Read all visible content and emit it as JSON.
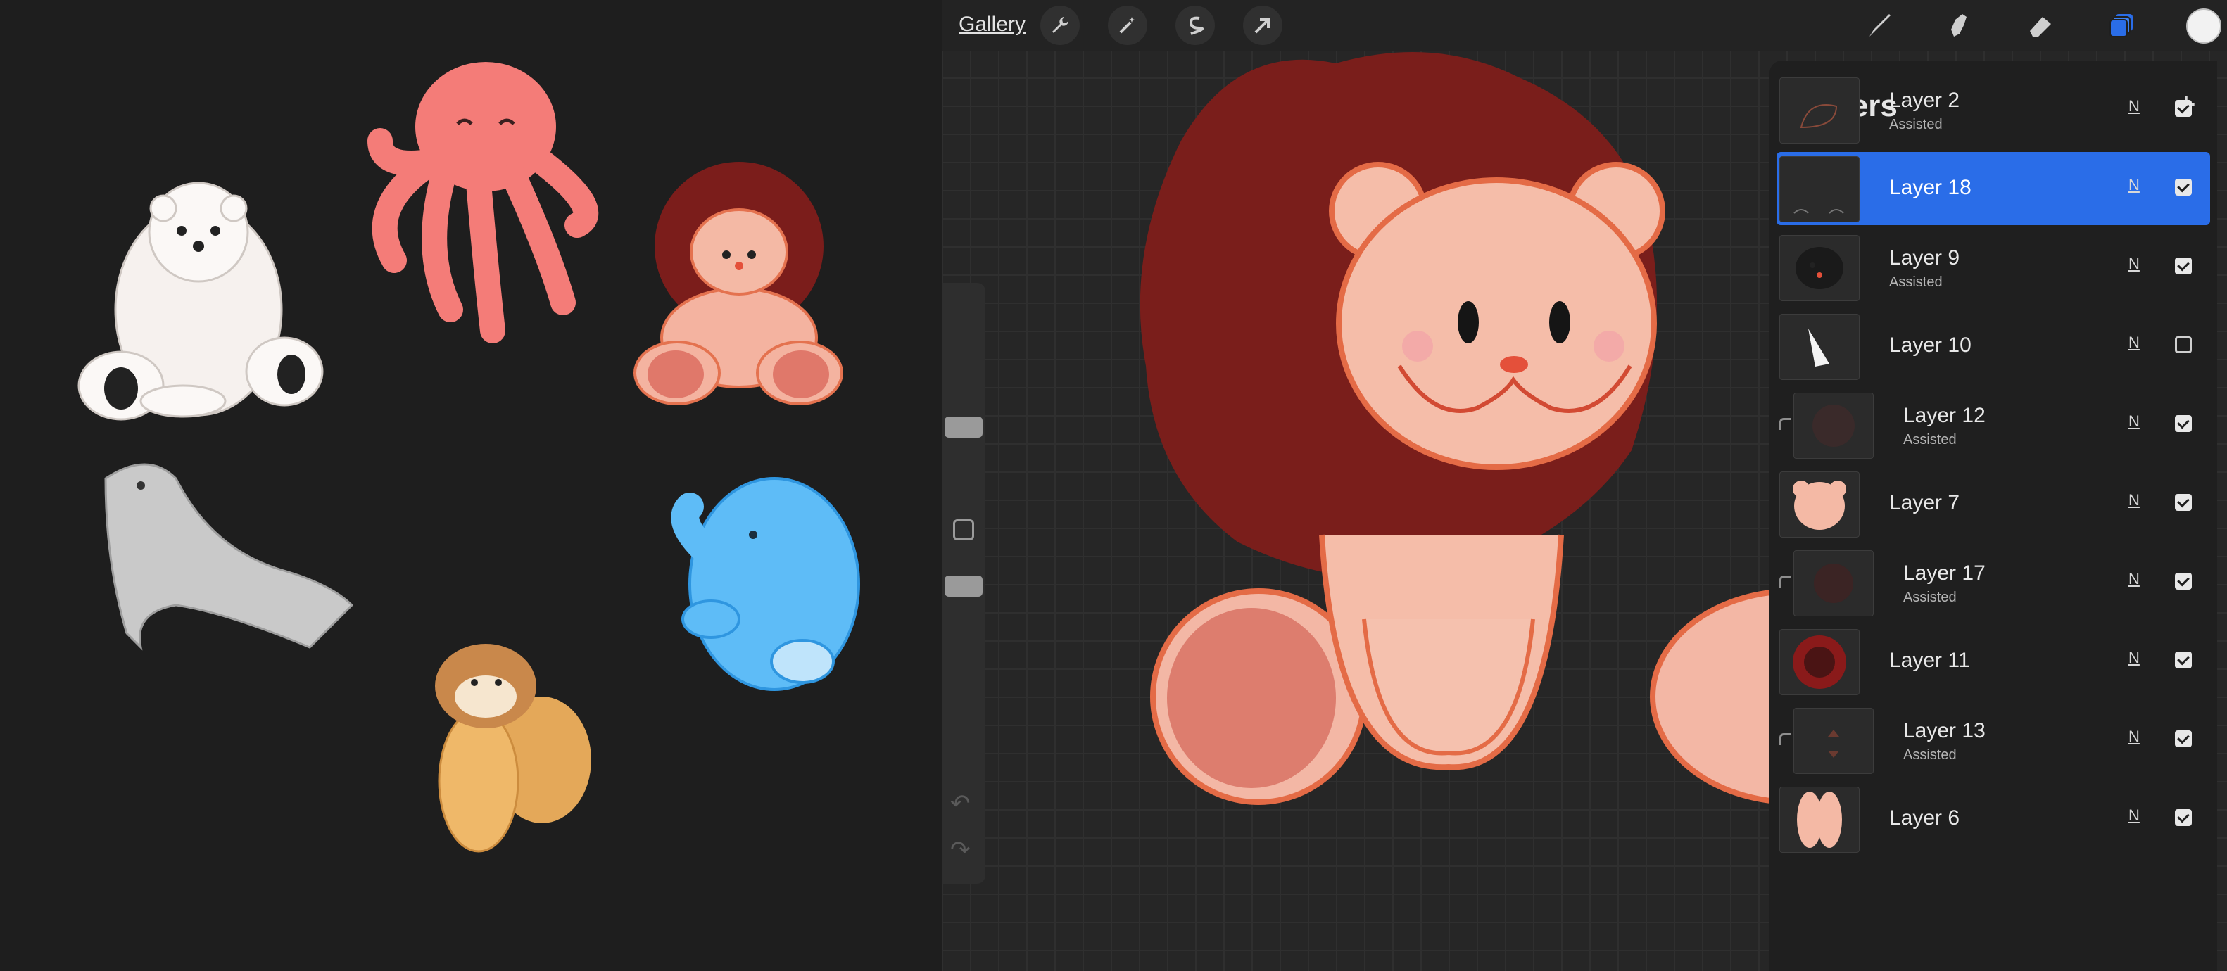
{
  "topbar": {
    "gallery_label": "Gallery",
    "left_tools": [
      "wrench-icon",
      "magic-wand-icon",
      "selection-s-icon",
      "transform-arrow-icon"
    ],
    "right_tools": [
      "brush-icon",
      "smudge-icon",
      "eraser-icon",
      "layers-icon"
    ],
    "color": "#f2f2f2"
  },
  "reference_images": [
    "polar-bear",
    "octopus",
    "lion",
    "seal",
    "elephant",
    "squirrel"
  ],
  "layers_panel": {
    "title": "Layers",
    "add_label": "+",
    "accent": "#2a6de8",
    "layers": [
      {
        "name": "Layer 2",
        "sub": "Assisted",
        "blend": "N",
        "visible": true,
        "selected": false,
        "clipped": false
      },
      {
        "name": "Layer 18",
        "sub": "",
        "blend": "N",
        "visible": true,
        "selected": true,
        "clipped": false
      },
      {
        "name": "Layer 9",
        "sub": "Assisted",
        "blend": "N",
        "visible": true,
        "selected": false,
        "clipped": false
      },
      {
        "name": "Layer 10",
        "sub": "",
        "blend": "N",
        "visible": false,
        "selected": false,
        "clipped": false
      },
      {
        "name": "Layer 12",
        "sub": "Assisted",
        "blend": "N",
        "visible": true,
        "selected": false,
        "clipped": true
      },
      {
        "name": "Layer 7",
        "sub": "",
        "blend": "N",
        "visible": true,
        "selected": false,
        "clipped": false
      },
      {
        "name": "Layer 17",
        "sub": "Assisted",
        "blend": "N",
        "visible": true,
        "selected": false,
        "clipped": true
      },
      {
        "name": "Layer 11",
        "sub": "",
        "blend": "N",
        "visible": true,
        "selected": false,
        "clipped": false
      },
      {
        "name": "Layer 13",
        "sub": "Assisted",
        "blend": "N",
        "visible": true,
        "selected": false,
        "clipped": true
      },
      {
        "name": "Layer 6",
        "sub": "",
        "blend": "N",
        "visible": true,
        "selected": false,
        "clipped": false
      }
    ]
  },
  "sidebar": {
    "undo_icon": "undo-icon",
    "redo_icon": "redo-icon"
  }
}
